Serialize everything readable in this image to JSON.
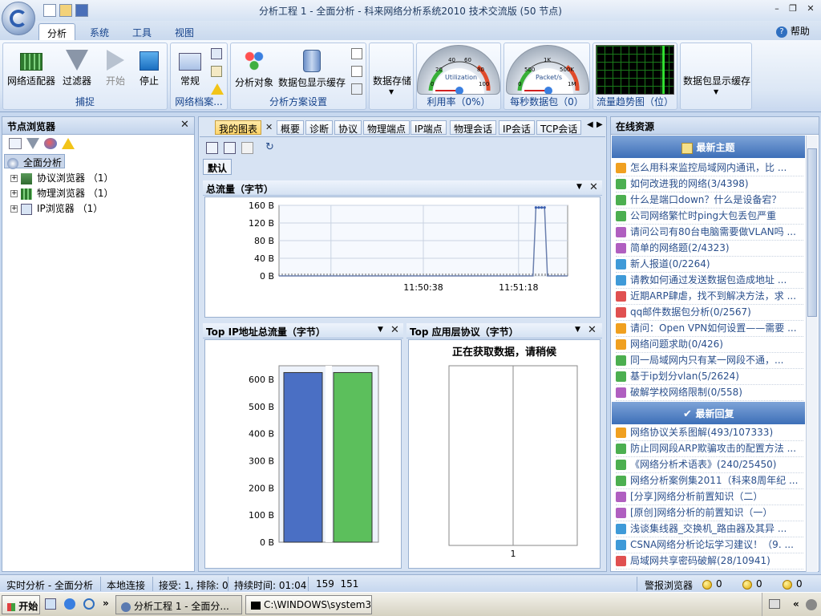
{
  "window": {
    "title": "分析工程 1 - 全面分析 - 科来网络分析系统2010 技术交流版 (50 节点)",
    "minimize": "–",
    "restore": "❐",
    "close": "✕"
  },
  "ribbon": {
    "tabs": [
      "分析",
      "系统",
      "工具",
      "视图"
    ],
    "help_label": "帮助",
    "groups": {
      "capture": {
        "label": "捕捉",
        "adapter": "网络适配器",
        "filter": "过滤器",
        "start": "开始",
        "stop": "停止"
      },
      "profile": {
        "label": "网络档案...",
        "normal": "常规"
      },
      "scheme": {
        "label": "分析方案设置",
        "objects": "分析对象",
        "packet_cache": "数据包显示缓存"
      },
      "storage": {
        "label": "数据存储"
      },
      "utilization": {
        "label": "利用率（0%）",
        "gauge_text": "Utilization",
        "ticks": [
          "0",
          "20",
          "40",
          "60",
          "80",
          "100"
        ]
      },
      "pps": {
        "label": "每秒数据包（0）",
        "gauge_text": "Packet/s",
        "ticks": [
          "0",
          "500",
          "1K",
          "500K",
          "1M"
        ]
      },
      "trend": {
        "label": "流量趋势图（位）"
      },
      "packet_cache2": {
        "label": "数据包显示缓存"
      }
    }
  },
  "left": {
    "title": "节点浏览器",
    "close": "✕",
    "root": "全面分析",
    "items": [
      {
        "label": "协议浏览器",
        "count": "（1）"
      },
      {
        "label": "物理浏览器",
        "count": "（1）"
      },
      {
        "label": "IP浏览器",
        "count": "（1）"
      }
    ]
  },
  "center": {
    "tabs": [
      "我的图表",
      "概要",
      "诊断",
      "协议",
      "物理端点",
      "IP端点",
      "物理会话",
      "IP会话",
      "TCP会话"
    ],
    "tab_close": "✕",
    "nav_prev": "◀",
    "nav_next": "▶",
    "default_label": "默认",
    "charts": {
      "total": {
        "title": "总流量（字节）"
      },
      "topip": {
        "title": "Top IP地址总流量（字节）"
      },
      "topapp": {
        "title": "Top 应用层协议（字节）",
        "loading": "正在获取数据，请稍候"
      }
    }
  },
  "chart_data": [
    {
      "type": "line",
      "title": "总流量（字节）",
      "y_ticks": [
        "0 B",
        "40 B",
        "80 B",
        "120 B",
        "160 B"
      ],
      "x_ticks": [
        "11:50:38",
        "11:51:18"
      ],
      "ylim": [
        0,
        160
      ],
      "x": [
        0,
        10,
        20,
        30,
        40,
        50,
        60,
        70,
        80,
        88,
        89,
        90,
        91,
        92,
        93,
        100
      ],
      "values": [
        0,
        0,
        0,
        0,
        0,
        0,
        0,
        0,
        0,
        0,
        155,
        155,
        155,
        155,
        0,
        0
      ],
      "grid": true
    },
    {
      "type": "bar",
      "title": "Top IP地址总流量（字节）",
      "y_ticks": [
        "0 B",
        "100 B",
        "200 B",
        "300 B",
        "400 B",
        "500 B",
        "600 B"
      ],
      "ylim": [
        0,
        650
      ],
      "values": [
        625,
        625
      ],
      "colors": [
        "#4a6fc4",
        "#5cbf5c"
      ]
    },
    {
      "type": "bar",
      "title": "Top 应用层协议（字节）",
      "x_ticks": [
        "1"
      ],
      "values": []
    }
  ],
  "right": {
    "title": "在线资源",
    "latest_topics_title": "最新主题",
    "latest_replies_title": "最新回复",
    "topics": [
      "怎么用科来监控局域网内通讯，比 ...",
      "如何改进我的网络(3/4398)",
      "什么是端口down？什么是设备宕？",
      "公司网络繁忙时ping大包丢包严重",
      "请问公司有80台电脑需要做VLAN吗 ...",
      "简单的网络题(2/4323)",
      "新人报道(0/2264)",
      "请教如何通过发送数据包造成地址 ...",
      "近期ARP肆虐，找不到解决方法，求 ...",
      "qq邮件数据包分析(0/2567)",
      "请问：Open VPN如何设置——需要 ...",
      "网络问题求助(0/426)",
      "同一局域网内只有某一网段不通，...",
      "基于ip划分vlan(5/2624)",
      "破解学校网络限制(0/558)"
    ],
    "replies": [
      "网络协议关系图解(493/107333)",
      "防止同网段ARP欺骗攻击的配置方法 ...",
      "《网络分析术语表》(240/25450)",
      "网络分析案例集2011（科来8周年纪 ...",
      "[分享]网络分析前置知识（二）",
      "[原创]网络分析的前置知识（一）",
      "浅谈集线器_交换机_路由器及其异 ...",
      "CSNA网络分析论坛学习建议！（9. ...",
      "局域网共享密码破解(28/10941)"
    ],
    "item_colors": [
      "#f0a020",
      "#4caf50",
      "#4caf50",
      "#4caf50",
      "#b05fc0",
      "#b05fc0",
      "#3f9ad8",
      "#3f9ad8",
      "#e05050",
      "#e05050",
      "#f0a020",
      "#f0a020",
      "#4caf50",
      "#4caf50",
      "#b05fc0"
    ]
  },
  "status": {
    "mode": "实时分析 - 全面分析",
    "connection": "本地连接",
    "recv": "接受: 1, 排除: 0",
    "duration": "持续时间: 01:04",
    "nums": "159  151",
    "alarm": "警报浏览器",
    "c1": "0",
    "c2": "0",
    "c3": "0"
  },
  "taskbar": {
    "start": "开始",
    "arrows": "»",
    "task1": "分析工程 1 - 全面分...",
    "task2": "C:\\WINDOWS\\system32...",
    "tray_arrows": "«"
  }
}
